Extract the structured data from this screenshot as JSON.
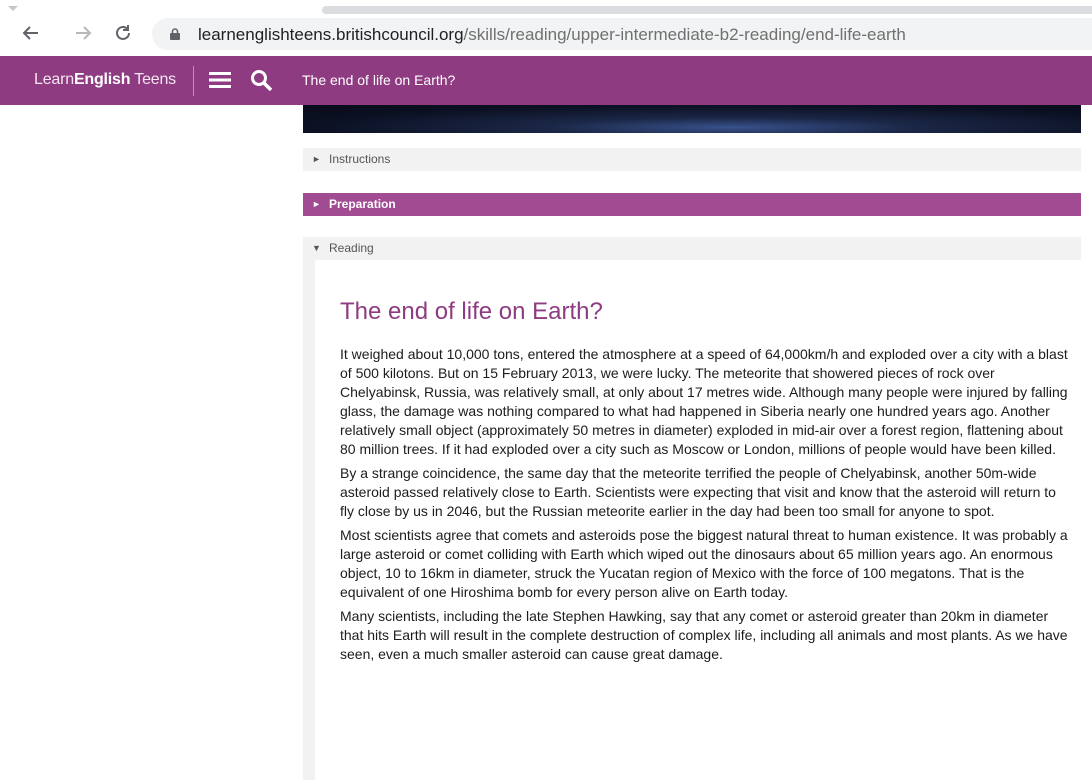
{
  "browser": {
    "back_icon": "back-arrow-icon",
    "forward_icon": "forward-arrow-icon",
    "reload_icon": "reload-icon",
    "lock_icon": "lock-icon",
    "url_domain": "learnenglishteens.britishcouncil.org",
    "url_path": "/skills/reading/upper-intermediate-b2-reading/end-life-earth"
  },
  "header": {
    "logo_prefix": "Learn",
    "logo_bold": "English",
    "logo_suffix": " Teens",
    "title": "The end of life on Earth?",
    "menu_icon": "hamburger-menu-icon",
    "search_icon": "search-icon",
    "bg_color": "#8e3b82"
  },
  "sections": {
    "instructions": {
      "label": "Instructions",
      "arrow": "►"
    },
    "preparation": {
      "label": "Preparation",
      "arrow": "►"
    },
    "reading": {
      "label": "Reading",
      "arrow": "▼"
    }
  },
  "article": {
    "title": "The end of life on Earth?",
    "paragraphs": [
      "It weighed about 10,000 tons, entered the atmosphere at a speed of 64,000km/h and exploded over a city with a blast of 500 kilotons. But on 15 February 2013, we were lucky. The meteorite that showered pieces of rock over Chelyabinsk, Russia, was relatively small, at only about 17 metres wide. Although many people were injured by falling glass, the damage was nothing compared to what had happened in Siberia nearly one hundred years ago. Another relatively small object (approximately 50 metres in diameter) exploded in mid-air over a forest region, flattening about 80 million trees. If it had exploded over a city such as Moscow or London, millions of people would have been killed.",
      "By a strange coincidence, the same day that the meteorite terrified the people of Chelyabinsk, another 50m-wide asteroid passed relatively close to Earth. Scientists were expecting that visit and know that the asteroid will return to fly close by us in 2046, but the Russian meteorite earlier in the day had been too small for anyone to spot.",
      "Most scientists agree that comets and asteroids pose the biggest natural threat to human existence. It was probably a large asteroid or comet colliding with Earth which wiped out the dinosaurs about 65 million years ago. An enormous object, 10 to 16km in diameter, struck the Yucatan region of Mexico with the force of 100 megatons. That is the equivalent of one Hiroshima bomb for every person alive on Earth today.",
      "Many scientists, including the late Stephen Hawking, say that any comet or asteroid greater than 20km in diameter that hits Earth will result in the complete destruction of complex life, including all animals and most plants. As we have seen, even a much smaller asteroid can cause great damage."
    ]
  }
}
